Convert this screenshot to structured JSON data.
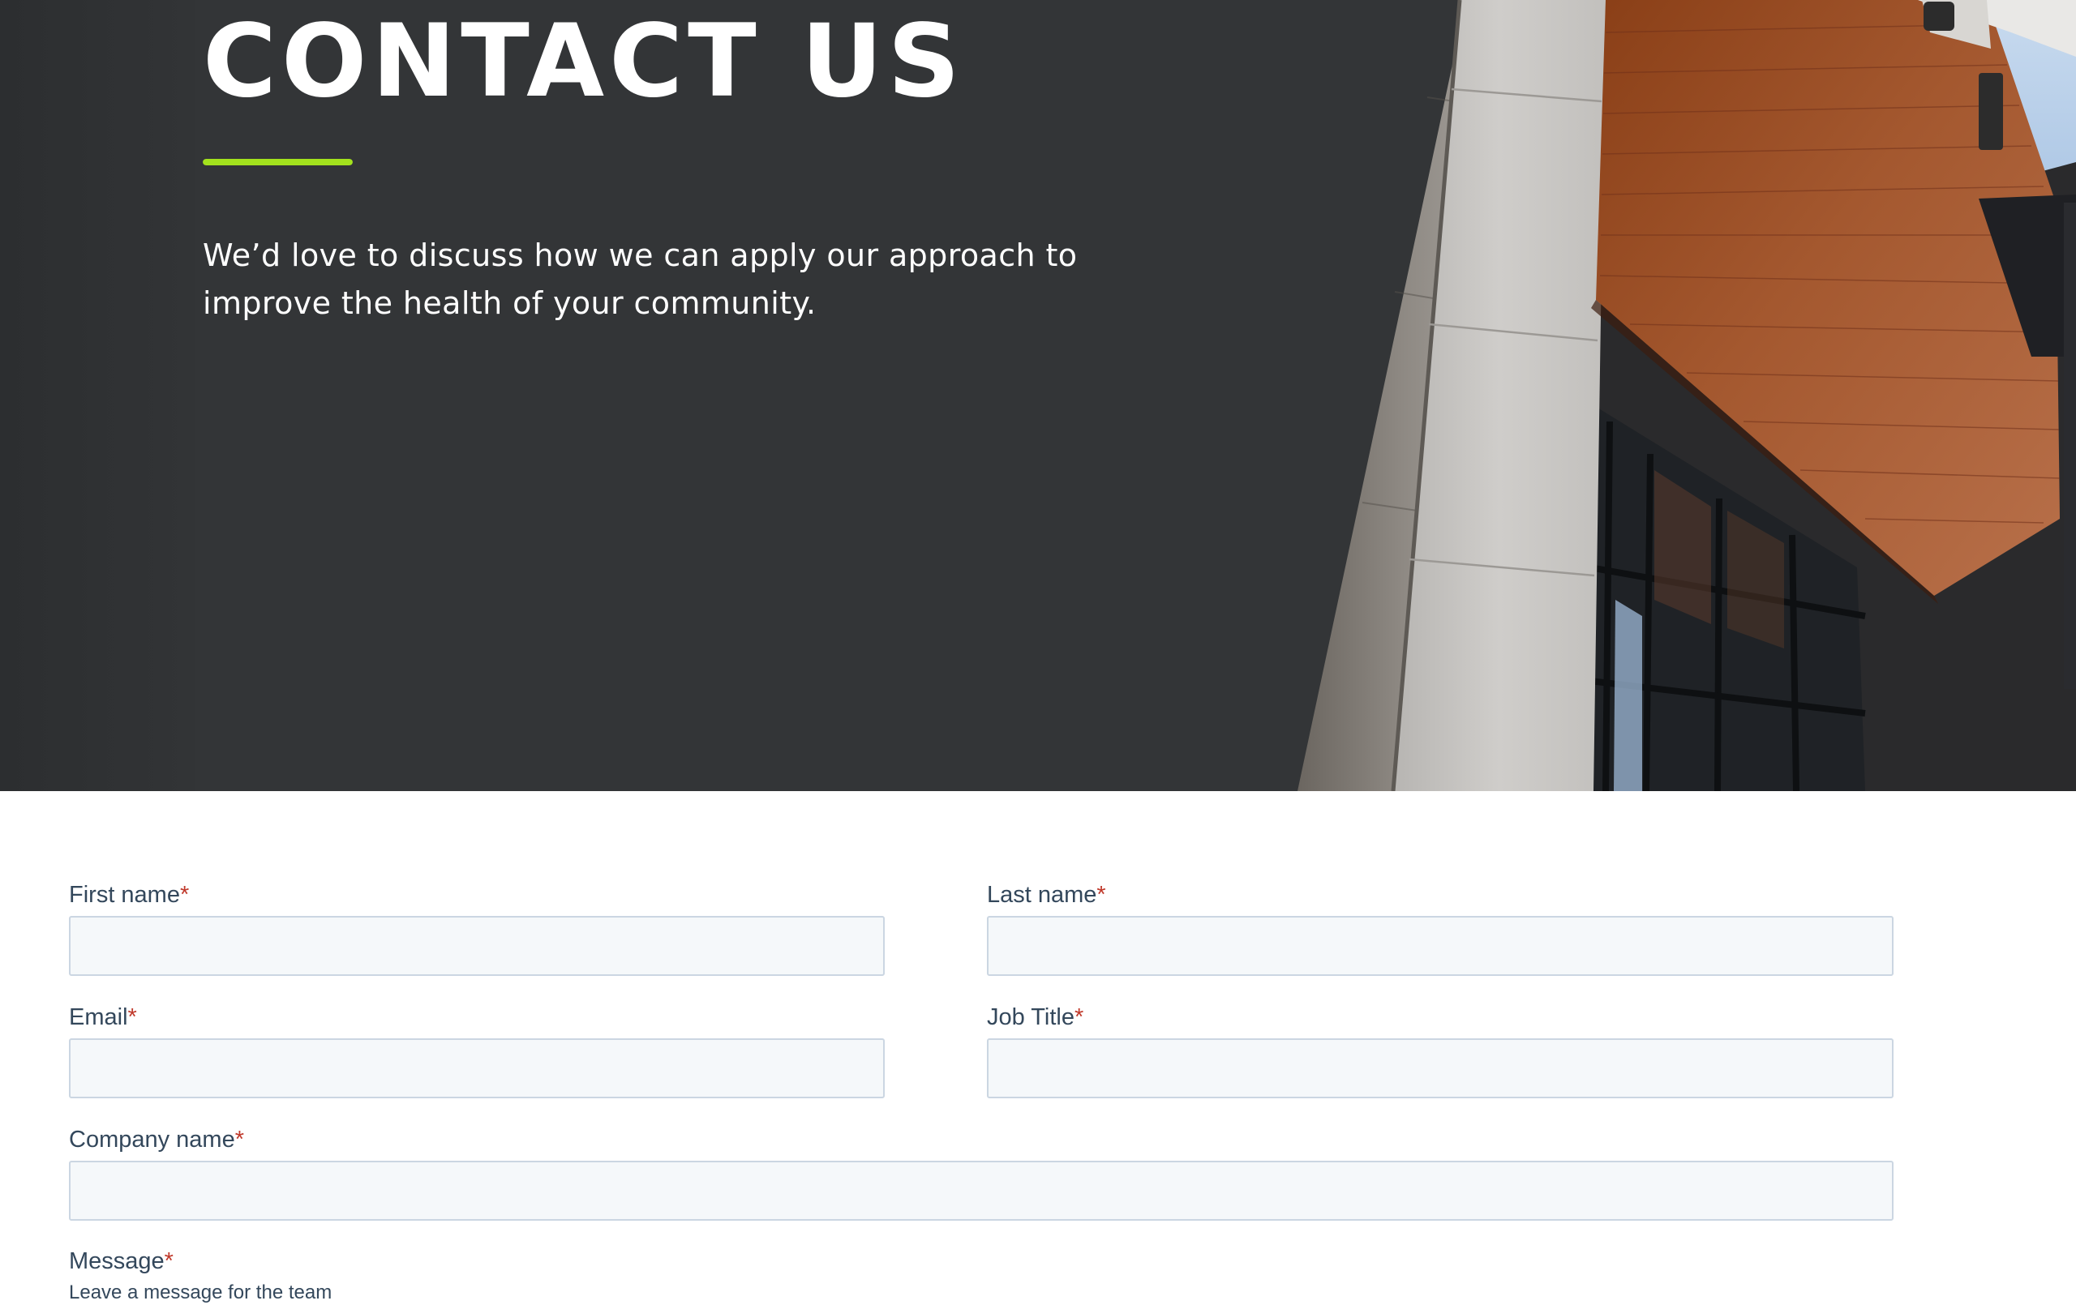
{
  "hero": {
    "title": "CONTACT US",
    "text": "We’d love to discuss how we can apply our approach to improve the health of your community.",
    "accent_color": "#a3e21d",
    "background_color": "#333537"
  },
  "form": {
    "required_marker": "*",
    "fields": {
      "first_name": {
        "label": "First name",
        "value": ""
      },
      "last_name": {
        "label": "Last name",
        "value": ""
      },
      "email": {
        "label": "Email",
        "value": ""
      },
      "job_title": {
        "label": "Job Title",
        "value": ""
      },
      "company_name": {
        "label": "Company name",
        "value": ""
      },
      "message": {
        "label": "Message",
        "help_text": "Leave a message for the team"
      }
    }
  }
}
